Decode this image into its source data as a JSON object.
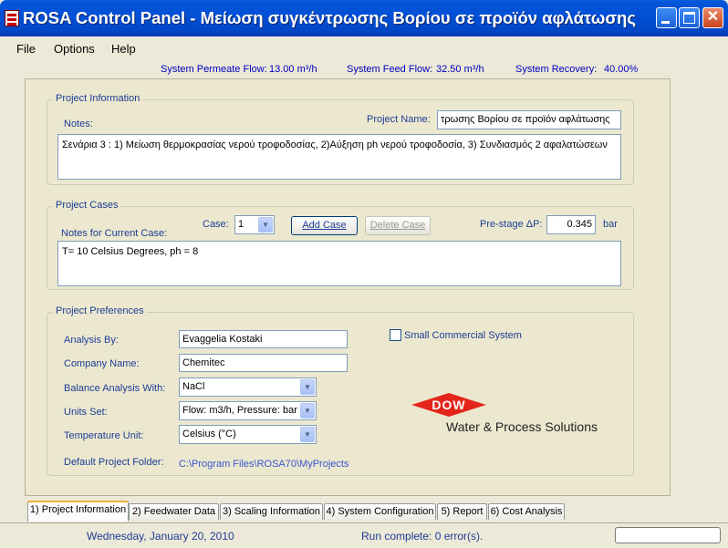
{
  "window": {
    "title": "ROSA Control Panel - Μείωση συγκέντρωσης Βορίου σε προϊόν αφλάτωσης",
    "close_glyph": "✕"
  },
  "menu": {
    "items": [
      {
        "label": "File"
      },
      {
        "label": "Options"
      },
      {
        "label": "Help"
      }
    ]
  },
  "system_status": {
    "permeate_label": "System Permeate Flow:",
    "permeate_value": "13.00 m³/h",
    "feed_label": "System Feed Flow:",
    "feed_value": "32.50 m³/h",
    "recovery_label": "System Recovery:",
    "recovery_value": "40.00%"
  },
  "project_information": {
    "group_title": "Project Information",
    "notes_label": "Notes:",
    "project_name_label": "Project Name:",
    "project_name_value": "τρωσης Βορίου σε προϊόν αφλάτωσης",
    "notes_value": "Σενάρια 3 : 1) Μείωση θερμοκρασίας νερού τροφοδοσίας, 2)Αύξηση ph νερού τροφοδοσία, 3) Συνδιασμός 2 αφαλατώσεων"
  },
  "project_cases": {
    "group_title": "Project Cases",
    "notes_label": "Notes for Current Case:",
    "case_label": "Case:",
    "case_value": "1",
    "add_case_label": "Add Case",
    "delete_case_label": "Delete Case",
    "prestage_label": "Pre-stage ΔP:",
    "prestage_value": "0.345",
    "prestage_unit": "bar",
    "case_notes_value": "T= 10 Celsius Degrees, ph = 8"
  },
  "project_preferences": {
    "group_title": "Project Preferences",
    "analysis_by_label": "Analysis By:",
    "analysis_by_value": "Evaggelia Kostaki",
    "company_label": "Company Name:",
    "company_value": "Chemitec",
    "balance_label": "Balance Analysis With:",
    "balance_value": "NaCl",
    "units_label": "Units Set:",
    "units_value": "Flow: m3/h, Pressure: bar",
    "temp_label": "Temperature Unit:",
    "temp_value": "Celsius (°C)",
    "folder_label": "Default Project Folder:",
    "folder_value": "C:\\Program Files\\ROSA70\\MyProjects",
    "small_commercial_label": "Small Commercial System",
    "small_commercial_checked": false
  },
  "brand": {
    "logo_text": "DOW",
    "tagline": "Water & Process Solutions",
    "red": "#e4251b"
  },
  "tabs": [
    {
      "label": "1) Project Information",
      "active": true
    },
    {
      "label": "2) Feedwater Data",
      "active": false
    },
    {
      "label": "3) Scaling Information",
      "active": false
    },
    {
      "label": "4) System Configuration",
      "active": false
    },
    {
      "label": "5) Report",
      "active": false
    },
    {
      "label": "6) Cost Analysis",
      "active": false
    }
  ],
  "statusbar": {
    "date": "Wednesday, January 20, 2010",
    "run_status": "Run complete: 0 error(s)."
  }
}
